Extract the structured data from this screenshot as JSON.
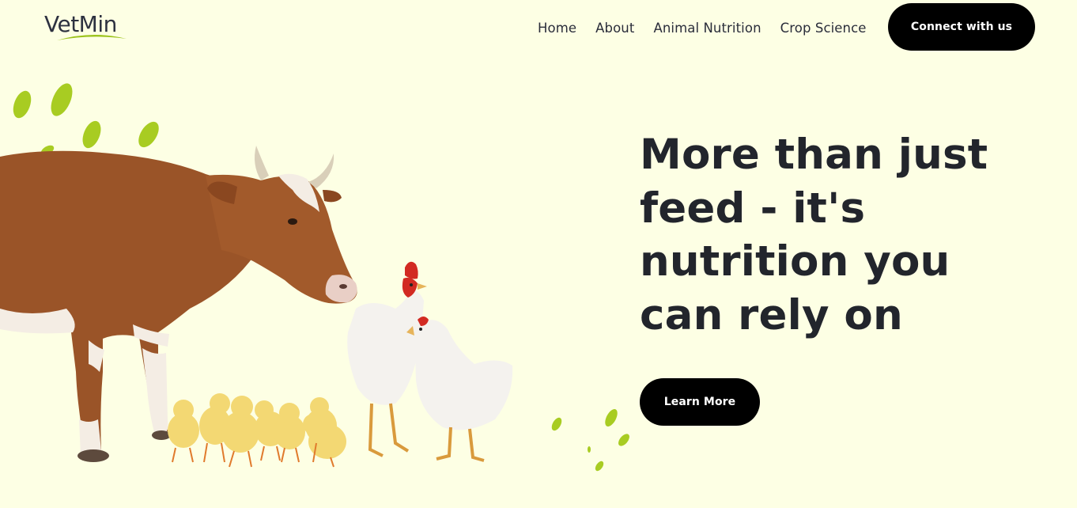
{
  "header": {
    "logo_text": "VetMin",
    "nav": [
      {
        "label": "Home"
      },
      {
        "label": "About"
      },
      {
        "label": "Animal Nutrition"
      },
      {
        "label": "Crop Science"
      }
    ],
    "cta_label": "Connect with us"
  },
  "hero": {
    "heading": "More than just feed - it's nutrition you can rely on",
    "button_label": "Learn More",
    "illustration": {
      "subjects": [
        "cow-icon",
        "rooster-icon",
        "hen-icon",
        "chick-icon",
        "leaf-icon"
      ],
      "chick_count": 7,
      "leaf_count": 10
    }
  },
  "colors": {
    "background": "#fdffe4",
    "text": "#22252c",
    "button": "#000000",
    "button_text": "#ffffff",
    "leaf": "#a8cc22",
    "logo_accent": "#9cc31c",
    "cow": "#9a5428",
    "chick": "#f3d873",
    "hen": "#f4f2ee",
    "comb": "#d22a22"
  }
}
